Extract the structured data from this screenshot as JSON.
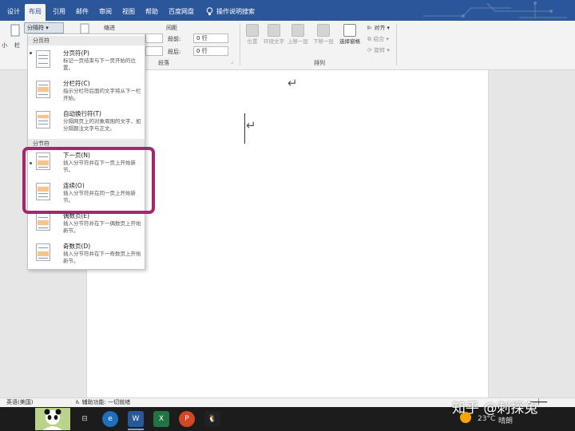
{
  "tabs": [
    {
      "label": "设计"
    },
    {
      "label": "布局"
    },
    {
      "label": "引用"
    },
    {
      "label": "邮件"
    },
    {
      "label": "审阅"
    },
    {
      "label": "视图"
    },
    {
      "label": "帮助"
    },
    {
      "label": "百度网盘"
    }
  ],
  "tell_me": "操作说明搜索",
  "ribbon": {
    "breaks_button": "分隔符",
    "left_small_1": "小",
    "left_small_2": "栏",
    "indent_label": "缩进",
    "spacing_label": "间距",
    "before_label": "段前:",
    "before_value": "0 行",
    "after_label": "段后:",
    "after_value": "0 行",
    "paragraph_group": "段落",
    "arrange_group": "排列",
    "position": "位置",
    "wrap_text": "环绕文字",
    "bring_forward": "上移一层",
    "send_backward": "下移一层",
    "selection_pane": "选择窗格",
    "align": "对齐",
    "group": "组合",
    "rotate": "旋转"
  },
  "dropdown": {
    "page_breaks_header": "分页符",
    "section_breaks_header": "分节符",
    "items": [
      {
        "title": "分页符(P)",
        "desc": "标记一页结束与下一页开始的位置。"
      },
      {
        "title": "分栏符(C)",
        "desc": "指示分栏符后面的文字将从下一栏开始。"
      },
      {
        "title": "自动换行符(T)",
        "desc": "分隔网页上的对象周围的文字，如分隔题注文字与正文。"
      },
      {
        "title": "下一页(N)",
        "desc": "插入分节符并在下一页上开始新节。"
      },
      {
        "title": "连续(O)",
        "desc": "插入分节符并在同一页上开始新节。"
      },
      {
        "title": "偶数页(E)",
        "desc": "插入分节符并在下一偶数页上开始新节。"
      },
      {
        "title": "奇数页(D)",
        "desc": "插入分节符并在下一奇数页上开始新节。"
      }
    ]
  },
  "document": {
    "return_mark": "↵"
  },
  "status": {
    "language": "英语(美国)",
    "accessibility": "辅助功能: 一切就绪"
  },
  "taskbar": {
    "temperature": "23°C",
    "weather": "晴朗"
  },
  "watermark": "知乎 @刺探兔",
  "colors": {
    "ribbon_blue": "#2b579a",
    "highlight": "#a3276b"
  }
}
